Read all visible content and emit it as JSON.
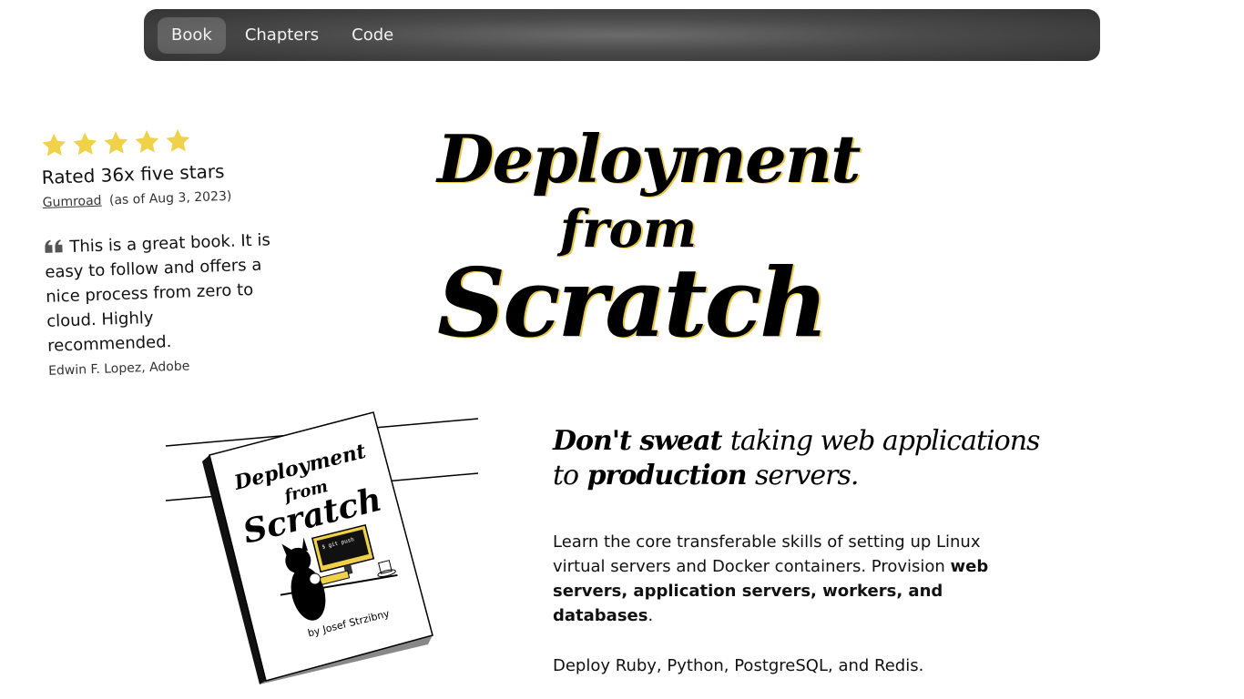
{
  "nav": {
    "items": [
      {
        "label": "Book",
        "active": true
      },
      {
        "label": "Chapters",
        "active": false
      },
      {
        "label": "Code",
        "active": false
      }
    ]
  },
  "review": {
    "star_count": 5,
    "rated": "Rated 36x five stars",
    "source_link": "Gumroad",
    "source_date": "(as of Aug 3, 2023)",
    "quote": "This is a great book. It is easy to follow and offers a nice process from zero to cloud. Highly recommended.",
    "author": "Edwin F. Lopez, Adobe"
  },
  "title": {
    "line1": "Deployment",
    "line2": "from",
    "line3": "Scratch"
  },
  "book_cover": {
    "title1": "Deployment",
    "title2": "from",
    "title3": "Scratch",
    "terminal_text": "$ git push",
    "byline": "by Josef Strzibny"
  },
  "tagline": {
    "part1": "Don't sweat",
    "part2": "taking web applications to",
    "part3": "production",
    "part4": "servers."
  },
  "intro": {
    "text_before": "Learn the core transferable skills of setting up Linux virtual servers and Docker containers. Provision ",
    "bold": "web servers, application servers, workers, and databases",
    "text_after": ".",
    "deploy": "Deploy Ruby, Python, PostgreSQL, and Redis."
  },
  "colors": {
    "star": "#f0d24a",
    "nav_bg": "#4a4a4a",
    "title_shadow": "#e8c94a"
  }
}
